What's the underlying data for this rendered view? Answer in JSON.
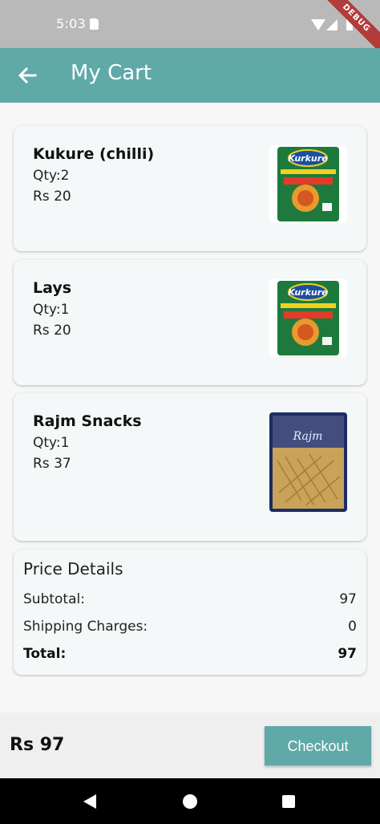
{
  "status_bar": {
    "time": "5:03",
    "debug_label": "DEBUG"
  },
  "app_bar": {
    "title": "My Cart",
    "back_icon": "arrow-left-icon"
  },
  "cart": {
    "items": [
      {
        "name": "Kukure (chilli)",
        "qty": "Qty:2",
        "price": "Rs 20",
        "image": "kurkure-chilli-khatka-pack"
      },
      {
        "name": "Lays",
        "qty": "Qty:1",
        "price": "Rs 20",
        "image": "kurkure-chilli-khatka-pack"
      },
      {
        "name": "Rajm Snacks",
        "qty": "Qty:1",
        "price": "Rs 37",
        "image": "rajm-snacks-pack"
      }
    ]
  },
  "price_details": {
    "title": "Price Details",
    "subtotal_label": "Subtotal:",
    "subtotal_value": "97",
    "shipping_label": "Shipping Charges:",
    "shipping_value": "0",
    "total_label": "Total:",
    "total_value": "97"
  },
  "bottom_bar": {
    "total": "Rs 97",
    "checkout_label": "Checkout"
  },
  "colors": {
    "accent": "#5fa9a9",
    "status_bar": "#b9b9b9",
    "card_bg": "#f5f8f9"
  }
}
